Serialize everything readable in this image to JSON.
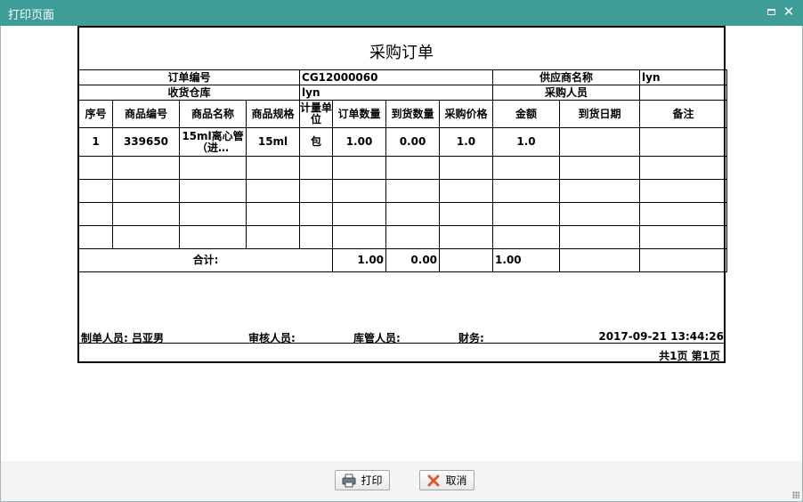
{
  "window": {
    "title": "打印页面"
  },
  "document": {
    "title": "采购订单",
    "meta": {
      "order_no_label": "订单编号",
      "order_no": "CG12000060",
      "supplier_label": "供应商名称",
      "supplier": "lyn",
      "warehouse_label": "收货仓库",
      "warehouse": "lyn",
      "buyer_label": "采购人员",
      "buyer": ""
    },
    "columns": [
      "序号",
      "商品编号",
      "商品名称",
      "商品规格",
      "计量单位",
      "订单数量",
      "到货数量",
      "采购价格",
      "金额",
      "到货日期",
      "备注"
    ],
    "rows": [
      {
        "no": "1",
        "code": "339650",
        "name": "15ml离心管（进…",
        "spec": "15ml",
        "unit": "包",
        "qty": "1.00",
        "arrived": "0.00",
        "price": "1.0",
        "amount": "1.0",
        "date": "",
        "note": ""
      }
    ],
    "totals": {
      "label": "合计:",
      "qty": "1.00",
      "arrived": "0.00",
      "price": "",
      "amount": "1.00"
    },
    "signatures": {
      "maker_label": "制单人员:",
      "maker": "吕亚男",
      "reviewer_label": "审核人员:",
      "keeper_label": "库管人员:",
      "finance_label": "财务:",
      "datetime": "2017-09-21 13:44:26"
    },
    "pager": "共1页 第1页"
  },
  "actions": {
    "print": "打印",
    "cancel": "取消"
  },
  "icons": {
    "maximize": "maximize-icon",
    "close": "close-icon",
    "print": "printer-icon",
    "cancel": "cancel-x-icon"
  },
  "colors": {
    "titlebar": "#3e9e97",
    "cancel_icon": "#e0582a"
  }
}
